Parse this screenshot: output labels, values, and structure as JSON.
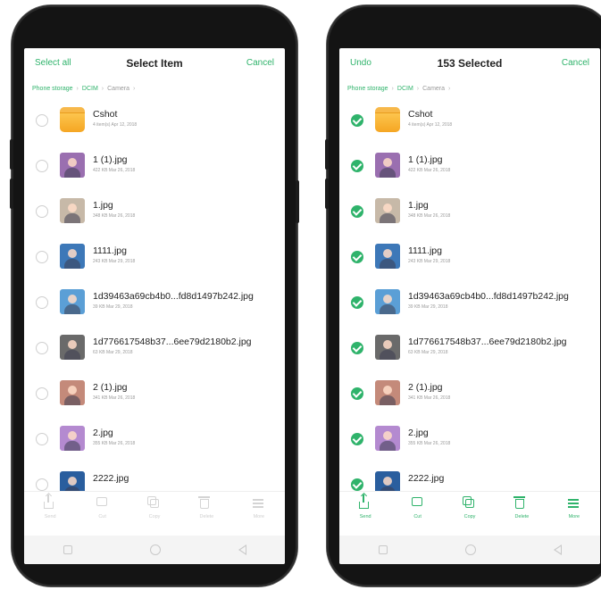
{
  "colors": {
    "accent": "#2fb36b"
  },
  "left_screen": {
    "header": {
      "left_action": "Select all",
      "title": "Select Item",
      "right_action": "Cancel"
    },
    "breadcrumb": [
      "Phone storage",
      "DCIM",
      "Camera"
    ],
    "items": [
      {
        "name": "Cshot",
        "meta": "4 item(s) Apr 12, 2018",
        "thumb": "folder-icon",
        "checked": false
      },
      {
        "name": "1 (1).jpg",
        "meta": "422 KB Mar 26, 2018",
        "thumb": "photo",
        "checked": false
      },
      {
        "name": "1.jpg",
        "meta": "348 KB Mar 26, 2018",
        "thumb": "photo",
        "checked": false
      },
      {
        "name": "1111.jpg",
        "meta": "243 KB Mar 29, 2018",
        "thumb": "photo",
        "checked": false
      },
      {
        "name": "1d39463a69cb4b0...fd8d1497b242.jpg",
        "meta": "39 KB Mar 29, 2018",
        "thumb": "photo",
        "checked": false
      },
      {
        "name": "1d776617548b37...6ee79d2180b2.jpg",
        "meta": "63 KB Mar 29, 2018",
        "thumb": "photo",
        "checked": false
      },
      {
        "name": "2 (1).jpg",
        "meta": "341 KB Mar 26, 2018",
        "thumb": "photo",
        "checked": false
      },
      {
        "name": "2.jpg",
        "meta": "355 KB Mar 26, 2018",
        "thumb": "photo",
        "checked": false
      },
      {
        "name": "2222.jpg",
        "meta": "",
        "thumb": "photo",
        "checked": false
      }
    ],
    "actions": [
      {
        "label": "Send",
        "icon": "send-icon"
      },
      {
        "label": "Cut",
        "icon": "cut-icon"
      },
      {
        "label": "Copy",
        "icon": "copy-icon"
      },
      {
        "label": "Delete",
        "icon": "delete-icon"
      },
      {
        "label": "More",
        "icon": "more-icon"
      }
    ],
    "actions_enabled": false
  },
  "right_screen": {
    "header": {
      "left_action": "Undo",
      "title": "153 Selected",
      "right_action": "Cancel"
    },
    "breadcrumb": [
      "Phone storage",
      "DCIM",
      "Camera"
    ],
    "items": [
      {
        "name": "Cshot",
        "meta": "4 item(s) Apr 12, 2018",
        "thumb": "folder-icon",
        "checked": true
      },
      {
        "name": "1 (1).jpg",
        "meta": "422 KB Mar 26, 2018",
        "thumb": "photo",
        "checked": true
      },
      {
        "name": "1.jpg",
        "meta": "348 KB Mar 26, 2018",
        "thumb": "photo",
        "checked": true
      },
      {
        "name": "1111.jpg",
        "meta": "243 KB Mar 29, 2018",
        "thumb": "photo",
        "checked": true
      },
      {
        "name": "1d39463a69cb4b0...fd8d1497b242.jpg",
        "meta": "39 KB Mar 29, 2018",
        "thumb": "photo",
        "checked": true
      },
      {
        "name": "1d776617548b37...6ee79d2180b2.jpg",
        "meta": "63 KB Mar 29, 2018",
        "thumb": "photo",
        "checked": true
      },
      {
        "name": "2 (1).jpg",
        "meta": "341 KB Mar 26, 2018",
        "thumb": "photo",
        "checked": true
      },
      {
        "name": "2.jpg",
        "meta": "355 KB Mar 26, 2018",
        "thumb": "photo",
        "checked": true
      },
      {
        "name": "2222.jpg",
        "meta": "",
        "thumb": "photo",
        "checked": true
      }
    ],
    "actions": [
      {
        "label": "Send",
        "icon": "send-icon"
      },
      {
        "label": "Cut",
        "icon": "cut-icon"
      },
      {
        "label": "Copy",
        "icon": "copy-icon"
      },
      {
        "label": "Delete",
        "icon": "delete-icon"
      },
      {
        "label": "More",
        "icon": "more-icon"
      }
    ],
    "actions_enabled": true
  }
}
